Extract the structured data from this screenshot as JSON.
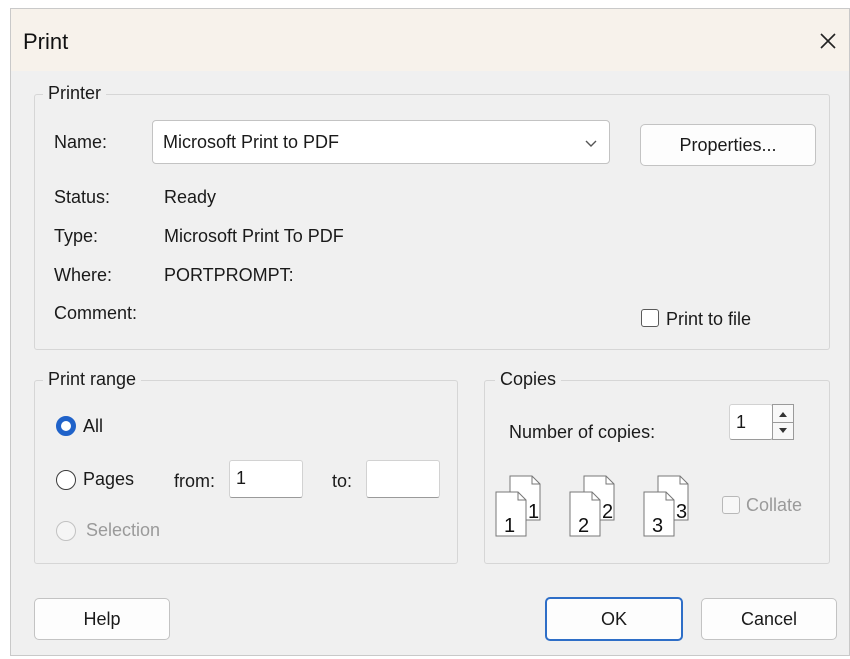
{
  "dialog": {
    "title": "Print"
  },
  "printer": {
    "group_label": "Printer",
    "name_label": "Name:",
    "name_value": "Microsoft Print to PDF",
    "properties_label": "Properties...",
    "status_label": "Status:",
    "status_value": "Ready",
    "type_label": "Type:",
    "type_value": "Microsoft Print To PDF",
    "where_label": "Where:",
    "where_value": "PORTPROMPT:",
    "comment_label": "Comment:",
    "print_to_file_label": "Print to file",
    "print_to_file_checked": false
  },
  "print_range": {
    "group_label": "Print range",
    "all_label": "All",
    "pages_label": "Pages",
    "from_label": "from:",
    "from_value": "1",
    "to_label": "to:",
    "to_value": "",
    "selection_label": "Selection",
    "selected": "All"
  },
  "copies": {
    "group_label": "Copies",
    "number_label": "Number of copies:",
    "number_value": "1",
    "collate_label": "Collate",
    "collate_checked": false,
    "collate_enabled": false,
    "page_icons": [
      {
        "back": "1",
        "front": "1"
      },
      {
        "back": "2",
        "front": "2"
      },
      {
        "back": "3",
        "front": "3"
      }
    ]
  },
  "footer": {
    "help_label": "Help",
    "ok_label": "OK",
    "cancel_label": "Cancel"
  },
  "colors": {
    "accent": "#1f62c9",
    "titlebar": "#f7f2eb",
    "dialog_bg": "#f0f0f0"
  },
  "icons": {
    "close": "close-icon",
    "dropdown": "chevron-down-icon",
    "spin_up": "arrow-up-icon",
    "spin_down": "arrow-down-icon"
  }
}
